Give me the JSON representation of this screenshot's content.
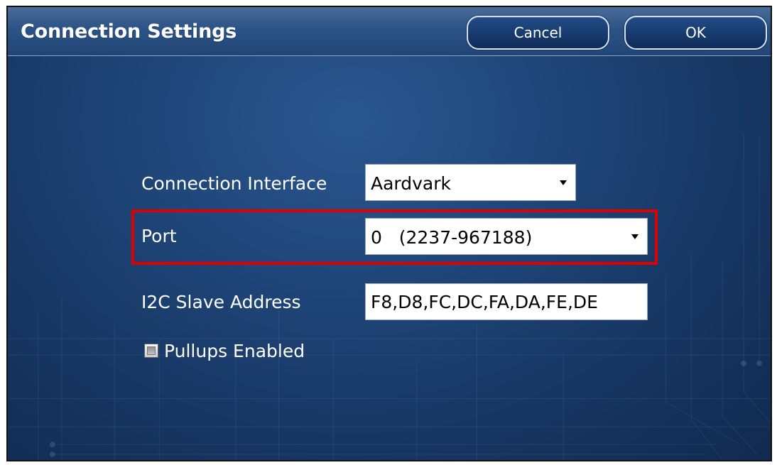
{
  "window": {
    "title": "Connection Settings",
    "buttons": {
      "cancel": "Cancel",
      "ok": "OK"
    }
  },
  "form": {
    "connection_interface": {
      "label": "Connection Interface",
      "selected": "Aardvark"
    },
    "port": {
      "label": "Port",
      "selected": "0   (2237-967188)"
    },
    "i2c_slave_address": {
      "label": "I2C Slave Address",
      "value": "F8,D8,FC,DC,FA,DA,FE,DE"
    },
    "pullups_enabled": {
      "label": "Pullups Enabled",
      "checked": false
    }
  },
  "colors": {
    "highlight": "#e00000",
    "window_background": "#1e4477",
    "button_border": "#d8e5f7"
  },
  "icons": {
    "dropdown": "chevron-down-icon"
  }
}
